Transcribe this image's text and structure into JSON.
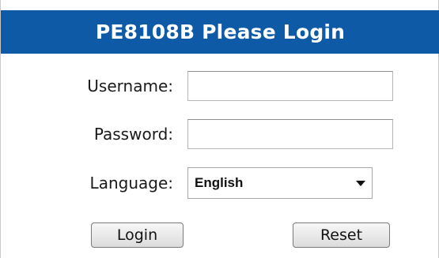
{
  "header": {
    "title": "PE8108B Please Login"
  },
  "form": {
    "username_label": "Username:",
    "username_value": "",
    "password_label": "Password:",
    "password_value": "",
    "language_label": "Language:",
    "language_selected": "English"
  },
  "buttons": {
    "login_label": "Login",
    "reset_label": "Reset"
  },
  "colors": {
    "header_bg": "#0e5aa7",
    "header_text": "#ffffff"
  },
  "icons": {
    "language_dropdown": "chevron-down-icon"
  }
}
